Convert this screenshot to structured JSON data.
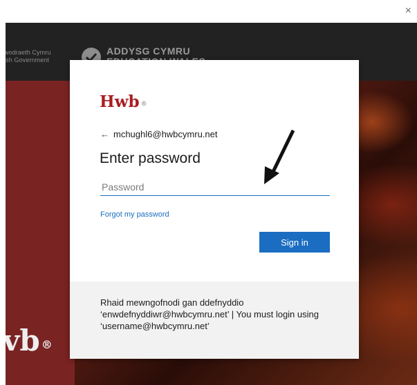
{
  "window": {
    "close_glyph": "×"
  },
  "header": {
    "gov_line1": "wodraeth Cymru",
    "gov_line2": "lsh Government",
    "edu_line1": "ADDYSG CYMRU",
    "edu_line2": "EDUCATION WALES"
  },
  "background": {
    "hwb_text": "vb",
    "hwb_mark": "®"
  },
  "dialog": {
    "brand": "Hwb",
    "brand_mark": "®",
    "back_arrow": "←",
    "account": "mchughl6@hwbcymru.net",
    "title": "Enter password",
    "password_placeholder": "Password",
    "forgot_label": "Forgot my password",
    "signin_label": "Sign in",
    "footer_text": "Rhaid mewngofnodi gan ddefnyddio ‘enwdefnyddiwr@hwbcymru.net’ | You must login using ‘username@hwbcymru.net’"
  },
  "colors": {
    "accent": "#1a6dc1",
    "brand": "#a91d22",
    "maroon": "#7a2323"
  }
}
